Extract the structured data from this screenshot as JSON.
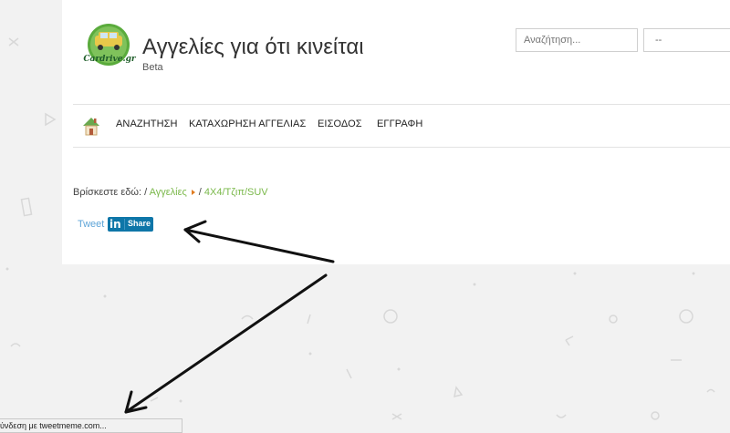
{
  "site": {
    "logo_text": "Cardrive.gr",
    "title": "Αγγελίες για ότι κινείται",
    "subtitle": "Beta"
  },
  "search": {
    "placeholder": "Αναζήτηση..."
  },
  "select": {
    "selected": "--"
  },
  "nav": {
    "items": [
      "ΑΝΑΖΗΤΗΣΗ",
      "ΚΑΤΑΧΩΡΗΣΗ ΑΓΓΕΛΙΑΣ",
      "ΕΙΣΟΔΟΣ",
      "ΕΓΓΡΑΦΗ"
    ]
  },
  "breadcrumb": {
    "prefix": "Βρίσκεστε εδώ:",
    "sep": "/",
    "items": [
      "Αγγελίες",
      "4X4/Τζιπ/SUV"
    ]
  },
  "social": {
    "tweet": "Tweet",
    "linkedin_in": "in",
    "linkedin_share": "Share"
  },
  "status": {
    "text": "ύνδεση με tweetmeme.com..."
  },
  "colors": {
    "accent_green": "#7ab84a",
    "linkedin": "#0e76a8",
    "tweet": "#5fa5d8",
    "breadcrumb_arrow": "#e07b20"
  },
  "icons": [
    "home-icon",
    "logo-car-icon",
    "arrow-annotation"
  ]
}
